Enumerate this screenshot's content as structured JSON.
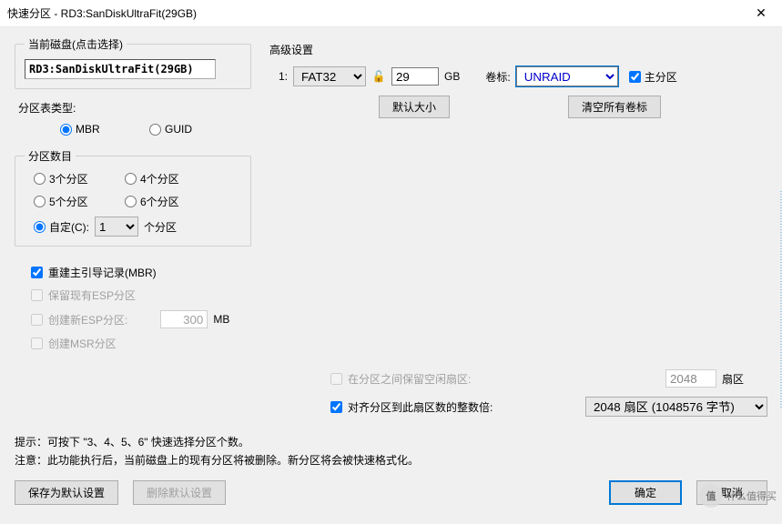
{
  "window": {
    "title": "快速分区 - RD3:SanDiskUltraFit(29GB)"
  },
  "currentDisk": {
    "legend": "当前磁盘(点击选择)",
    "value": "RD3:SanDiskUltraFit(29GB)"
  },
  "partitionTable": {
    "label": "分区表类型:",
    "mbr": "MBR",
    "guid": "GUID"
  },
  "partitionCount": {
    "legend": "分区数目",
    "p3": "3个分区",
    "p4": "4个分区",
    "p5": "5个分区",
    "p6": "6个分区",
    "customLabel": "自定(C):",
    "customValue": "1",
    "customSuffix": "个分区"
  },
  "checks": {
    "rebuildMbr": "重建主引导记录(MBR)",
    "keepEsp": "保留现有ESP分区",
    "newEsp": "创建新ESP分区:",
    "espSize": "300",
    "espUnit": "MB",
    "msr": "创建MSR分区"
  },
  "advanced": {
    "title": "高级设置",
    "index": "1:",
    "fs": "FAT32",
    "size": "29",
    "sizeUnit": "GB",
    "volLabel": "卷标:",
    "volValue": "UNRAID",
    "primary": "主分区",
    "defaultSizeBtn": "默认大小",
    "clearLabelsBtn": "清空所有卷标"
  },
  "reserve": {
    "label": "在分区之间保留空闲扇区:",
    "value": "2048",
    "unit": "扇区"
  },
  "align": {
    "label": "对齐分区到此扇区数的整数倍:",
    "value": "2048 扇区 (1048576 字节)"
  },
  "hints": {
    "line1": "提示：可按下 \"3、4、5、6\" 快速选择分区个数。",
    "line2": "注意：此功能执行后，当前磁盘上的现有分区将被删除。新分区将会被快速格式化。"
  },
  "buttons": {
    "saveDefault": "保存为默认设置",
    "deleteDefault": "删除默认设置",
    "ok": "确定",
    "cancel": "取消"
  },
  "watermark": {
    "badge": "值",
    "text": "什么值得买"
  }
}
